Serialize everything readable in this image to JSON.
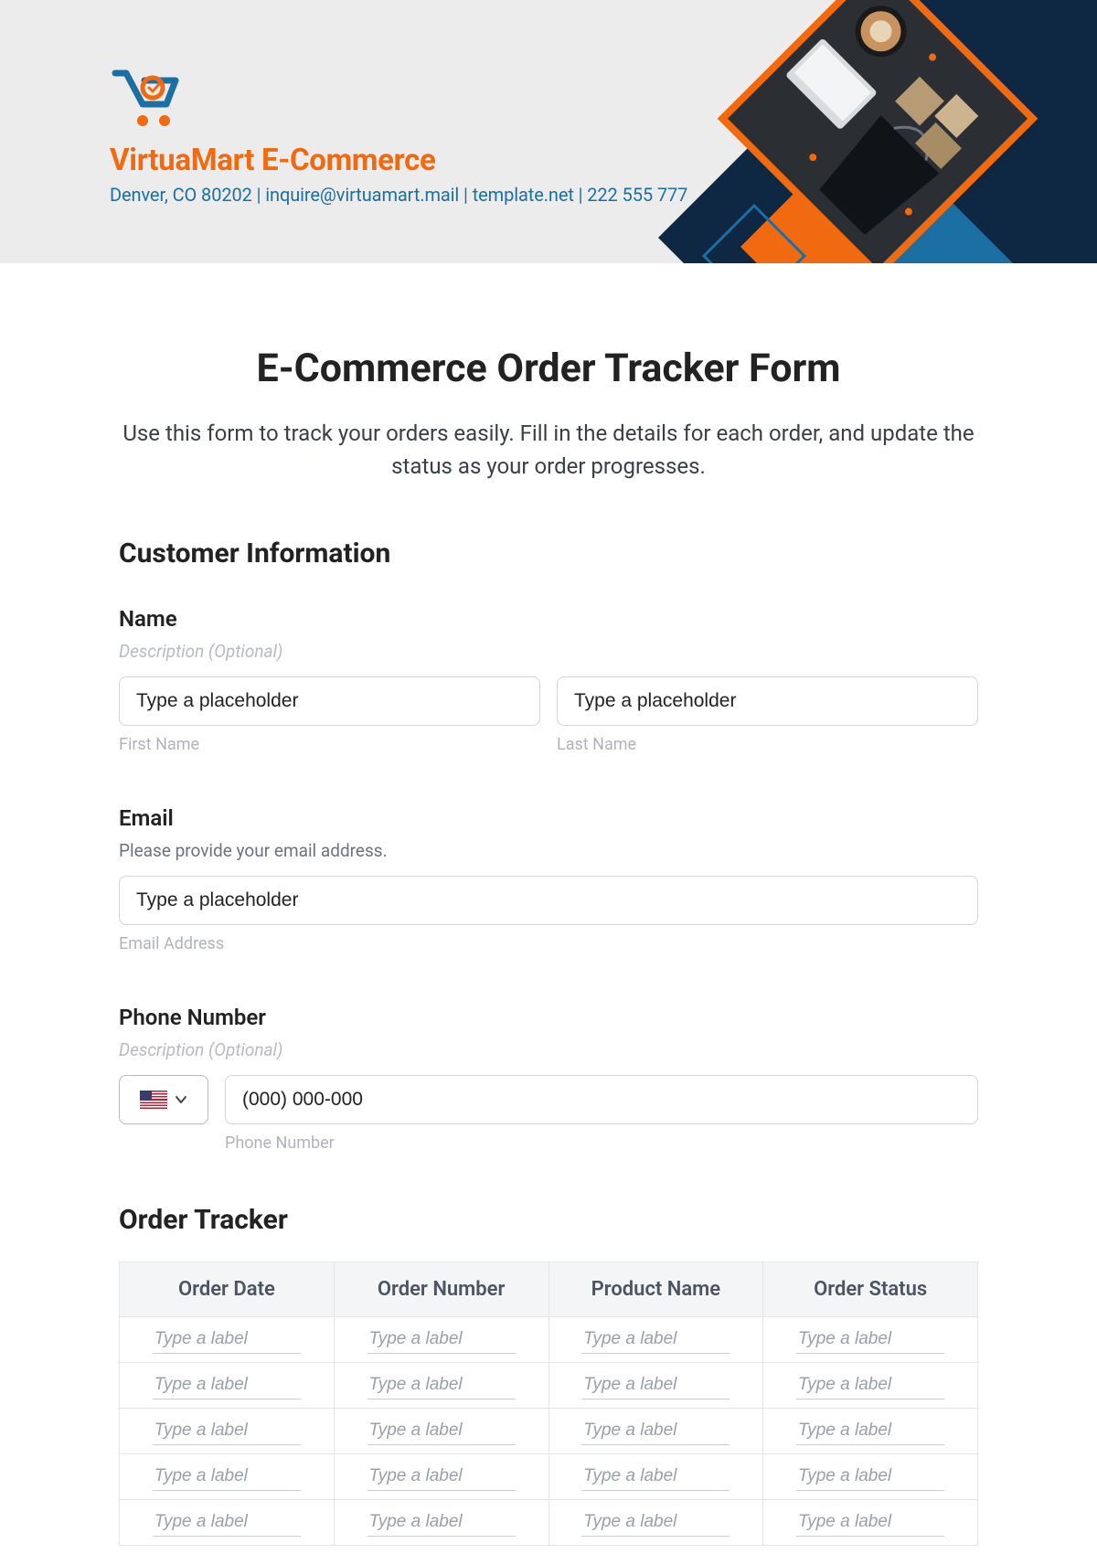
{
  "brand": {
    "name": "VirtuaMart E-Commerce",
    "contact_line": "Denver, CO 80202 | inquire@virtuamart.mail | template.net | 222 555 777"
  },
  "colors": {
    "accent_orange": "#f26a10",
    "accent_blue": "#1c6fa3",
    "navy": "#0e2844"
  },
  "page": {
    "title": "E-Commerce Order Tracker Form",
    "intro": "Use this form to track your orders easily. Fill in the details for each order, and update the status as your order progresses."
  },
  "sections": {
    "customer_heading": "Customer Information",
    "tracker_heading": "Order Tracker"
  },
  "fields": {
    "name": {
      "label": "Name",
      "desc": "Description (Optional)",
      "first_placeholder": "Type a placeholder",
      "first_sublabel": "First Name",
      "last_placeholder": "Type a placeholder",
      "last_sublabel": "Last Name"
    },
    "email": {
      "label": "Email",
      "desc": "Please provide your email address.",
      "placeholder": "Type a placeholder",
      "sublabel": "Email Address"
    },
    "phone": {
      "label": "Phone Number",
      "desc": "Description (Optional)",
      "placeholder": "(000) 000-000",
      "sublabel": "Phone Number"
    }
  },
  "tracker": {
    "columns": [
      "Order Date",
      "Order Number",
      "Product Name",
      "Order Status"
    ],
    "cell_placeholder": "Type a label",
    "row_count": 5
  }
}
